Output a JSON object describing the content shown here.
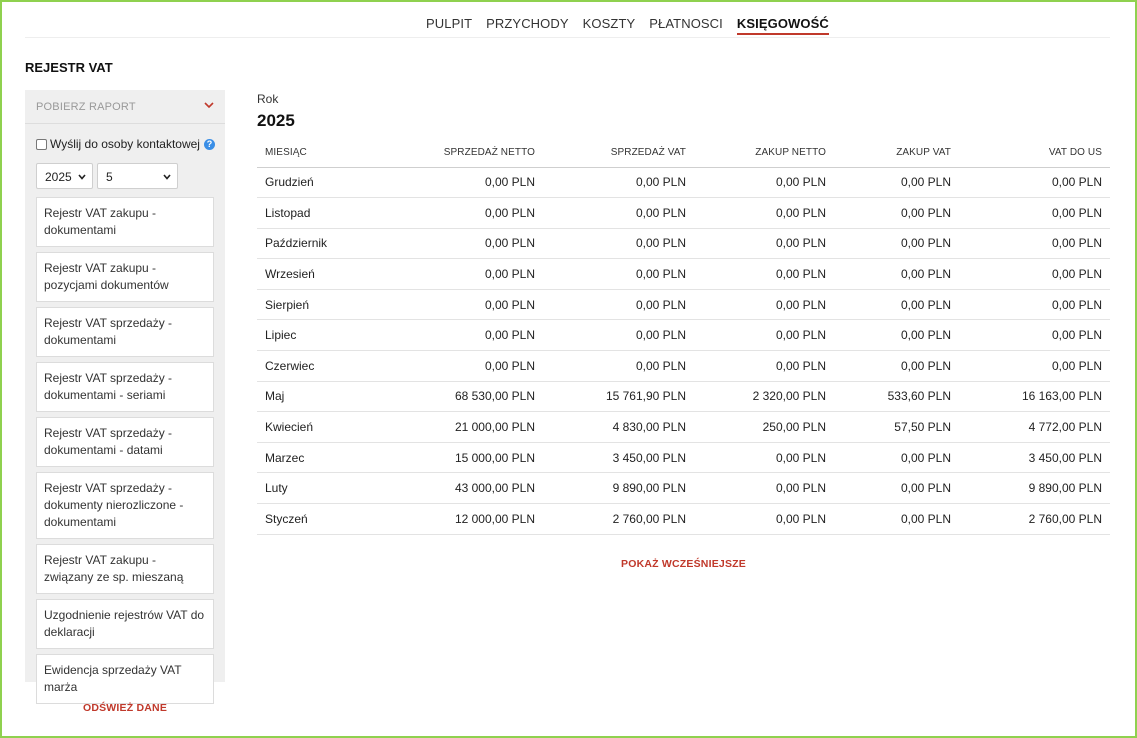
{
  "nav": {
    "items": [
      {
        "label": "PULPIT"
      },
      {
        "label": "PRZYCHODY"
      },
      {
        "label": "KOSZTY"
      },
      {
        "label": "PŁATNOSCI"
      },
      {
        "label": "KSIĘGOWOŚĆ"
      }
    ],
    "active": "KSIĘGOWOŚĆ"
  },
  "page_title": "REJESTR VAT",
  "sidebar": {
    "header_label": "POBIERZ RAPORT",
    "send_contact_label": "Wyślij do osoby kontaktowej",
    "send_contact_checked": false,
    "year_value": "2025",
    "month_value": "5",
    "reports": [
      {
        "label": "Rejestr VAT zakupu - dokumentami"
      },
      {
        "label": "Rejestr VAT zakupu - pozycjami dokumentów"
      },
      {
        "label": "Rejestr VAT sprzedaży - dokumentami"
      },
      {
        "label": "Rejestr VAT sprzedaży - dokumentami - seriami"
      },
      {
        "label": "Rejestr VAT sprzedaży - dokumentami - datami"
      },
      {
        "label": "Rejestr VAT sprzedaży - dokumenty nierozliczone - dokumentami"
      },
      {
        "label": "Rejestr VAT zakupu - związany ze sp. mieszaną"
      },
      {
        "label": "Uzgodnienie rejestrów VAT do deklaracji"
      },
      {
        "label": "Ewidencja sprzedaży VAT marża"
      }
    ],
    "refresh_label": "ODŚWIEŻ DANE"
  },
  "main": {
    "year_label": "Rok",
    "year_value": "2025",
    "columns": [
      "MIESIĄC",
      "SPRZEDAŻ NETTO",
      "SPRZEDAŻ VAT",
      "ZAKUP NETTO",
      "ZAKUP VAT",
      "VAT DO US"
    ],
    "rows": [
      {
        "cells": [
          "Grudzień",
          "0,00 PLN",
          "0,00 PLN",
          "0,00 PLN",
          "0,00 PLN",
          "0,00 PLN"
        ]
      },
      {
        "cells": [
          "Listopad",
          "0,00 PLN",
          "0,00 PLN",
          "0,00 PLN",
          "0,00 PLN",
          "0,00 PLN"
        ]
      },
      {
        "cells": [
          "Październik",
          "0,00 PLN",
          "0,00 PLN",
          "0,00 PLN",
          "0,00 PLN",
          "0,00 PLN"
        ]
      },
      {
        "cells": [
          "Wrzesień",
          "0,00 PLN",
          "0,00 PLN",
          "0,00 PLN",
          "0,00 PLN",
          "0,00 PLN"
        ]
      },
      {
        "cells": [
          "Sierpień",
          "0,00 PLN",
          "0,00 PLN",
          "0,00 PLN",
          "0,00 PLN",
          "0,00 PLN"
        ]
      },
      {
        "cells": [
          "Lipiec",
          "0,00 PLN",
          "0,00 PLN",
          "0,00 PLN",
          "0,00 PLN",
          "0,00 PLN"
        ]
      },
      {
        "cells": [
          "Czerwiec",
          "0,00 PLN",
          "0,00 PLN",
          "0,00 PLN",
          "0,00 PLN",
          "0,00 PLN"
        ]
      },
      {
        "cells": [
          "Maj",
          "68 530,00 PLN",
          "15 761,90 PLN",
          "2 320,00 PLN",
          "533,60 PLN",
          "16 163,00 PLN"
        ]
      },
      {
        "cells": [
          "Kwiecień",
          "21 000,00 PLN",
          "4 830,00 PLN",
          "250,00 PLN",
          "57,50 PLN",
          "4 772,00 PLN"
        ]
      },
      {
        "cells": [
          "Marzec",
          "15 000,00 PLN",
          "3 450,00 PLN",
          "0,00 PLN",
          "0,00 PLN",
          "3 450,00 PLN"
        ]
      },
      {
        "cells": [
          "Luty",
          "43 000,00 PLN",
          "9 890,00 PLN",
          "0,00 PLN",
          "0,00 PLN",
          "9 890,00 PLN"
        ]
      },
      {
        "cells": [
          "Styczeń",
          "12 000,00 PLN",
          "2 760,00 PLN",
          "0,00 PLN",
          "0,00 PLN",
          "2 760,00 PLN"
        ]
      }
    ],
    "show_more_label": "POKAŻ WCZEŚNIEJSZE"
  },
  "colors": {
    "accent": "#c0392b",
    "frame": "#8fd14f",
    "help_icon": "#3a8ee6",
    "sidebar_bg": "#efefef"
  },
  "icons": {
    "sidebar_toggle": "chevron-down-icon",
    "help": "help-icon",
    "select_arrow": "chevron-down-icon"
  }
}
